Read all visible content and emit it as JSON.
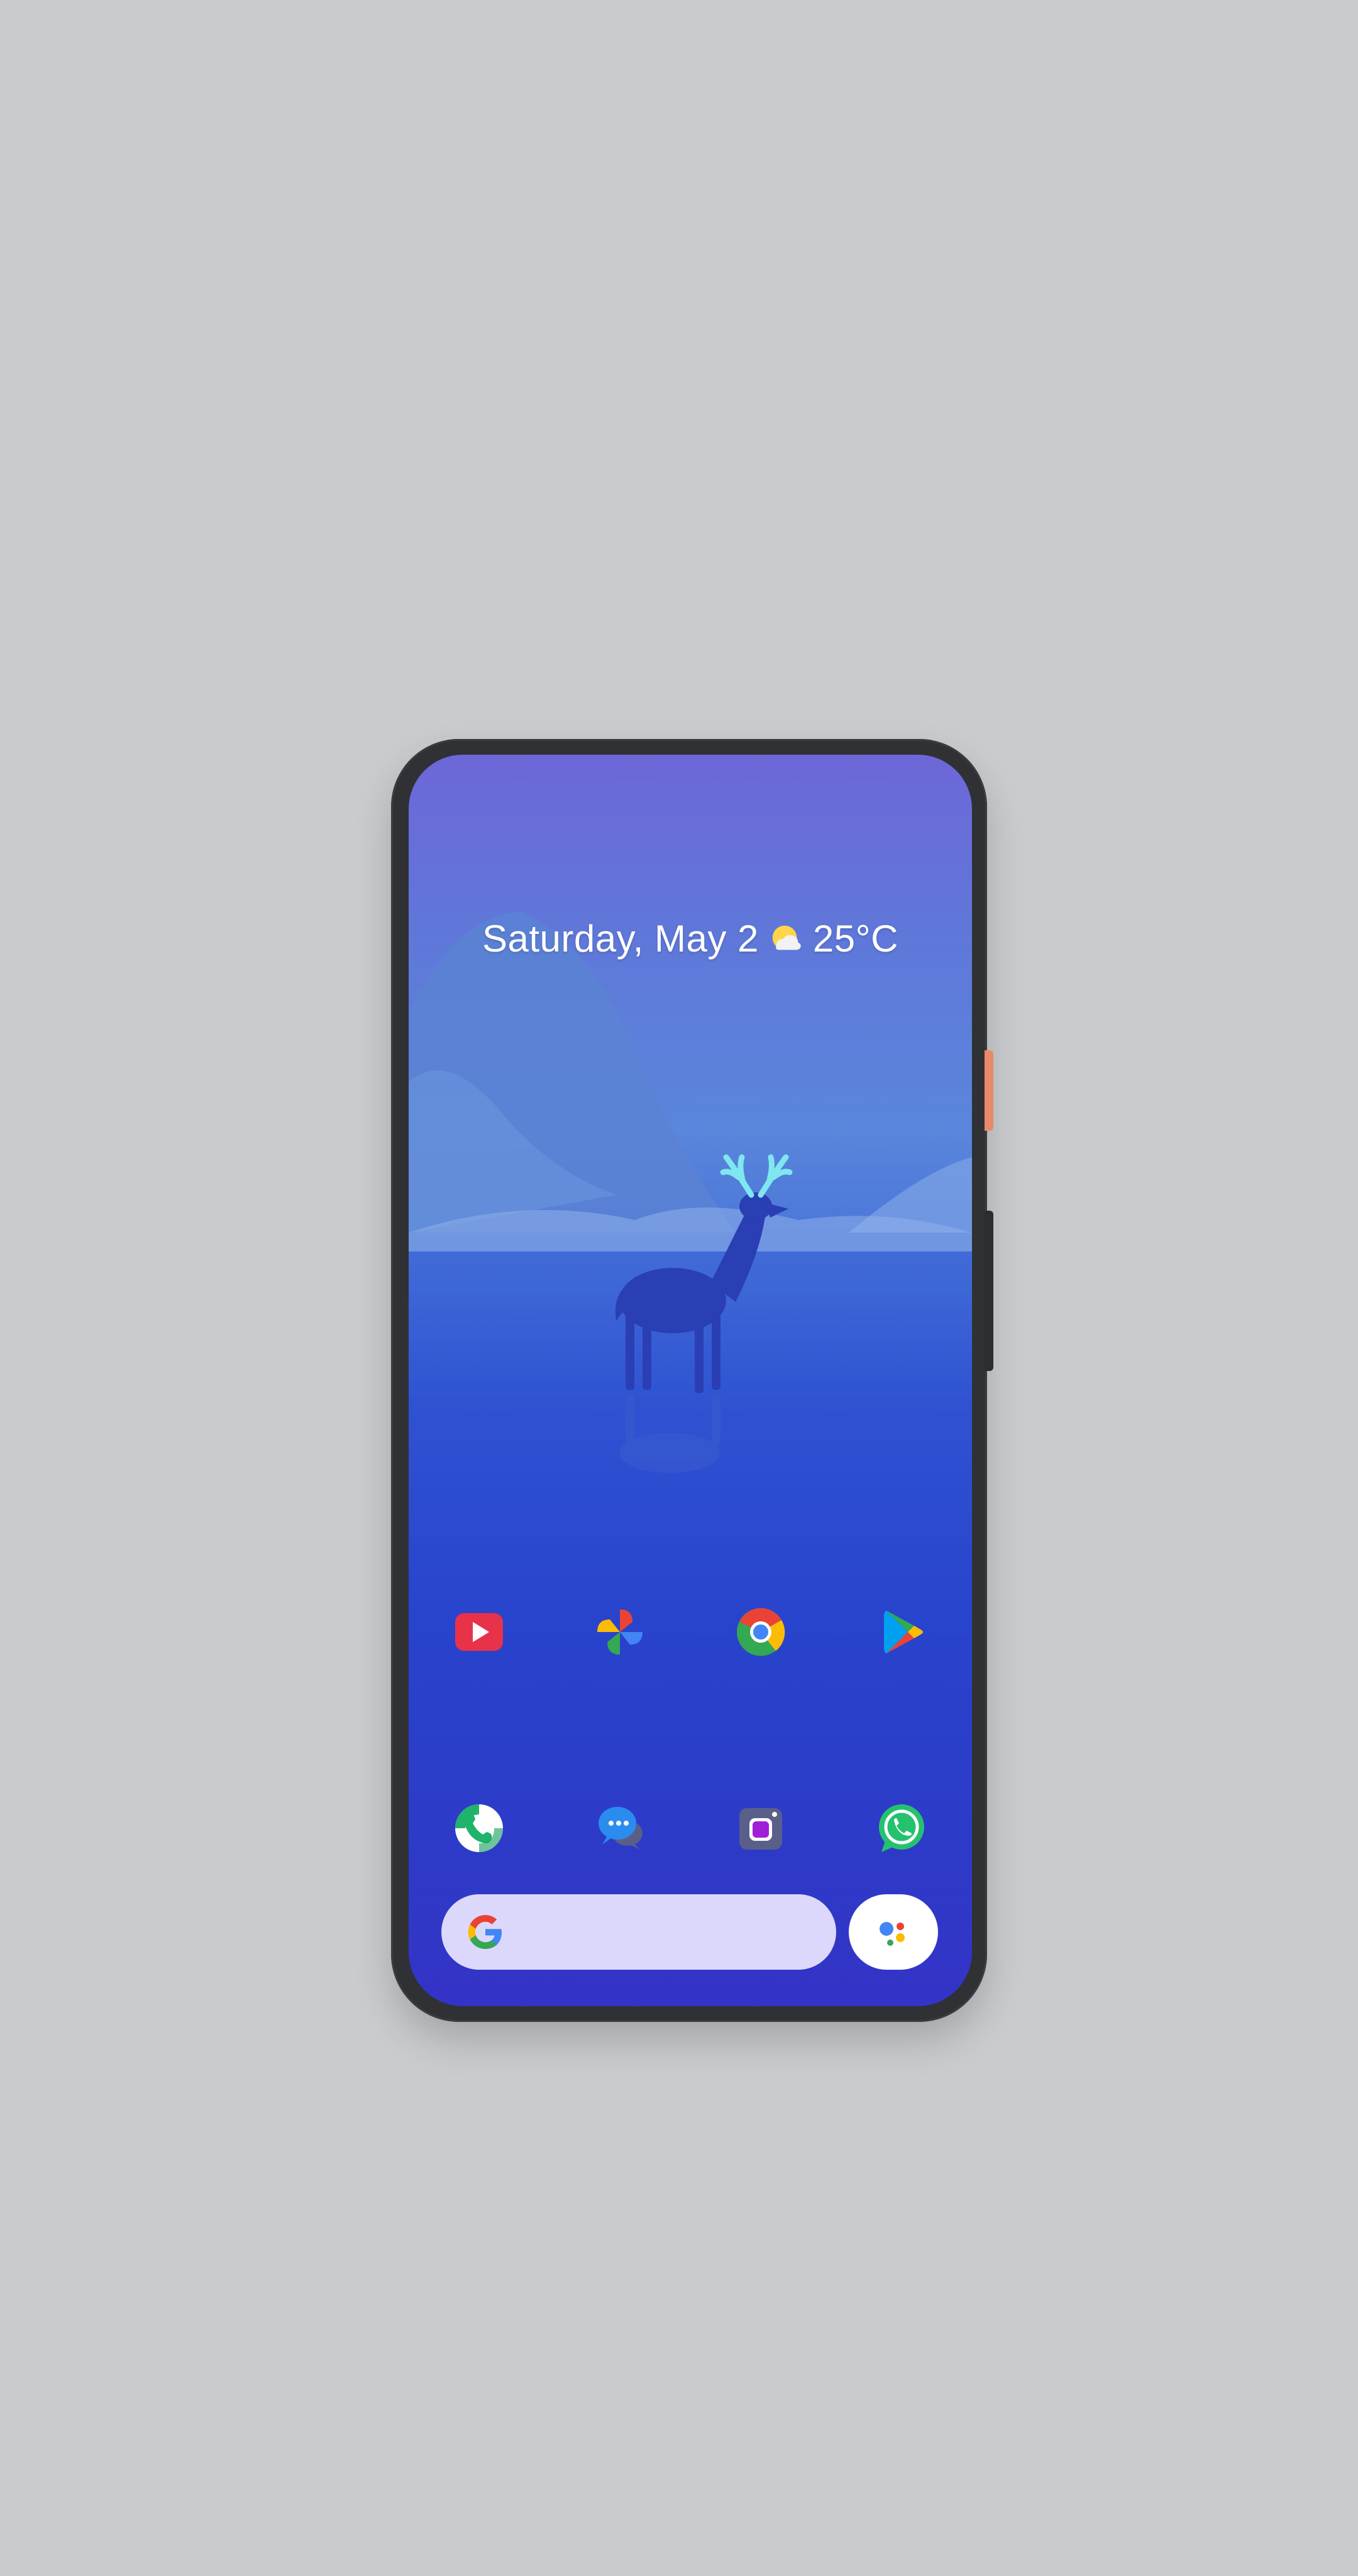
{
  "colors": {
    "background": "#c9cccf",
    "phone_frame": "#2f3134",
    "power_button": "#e88a6a",
    "search_bar": "#dcd8fb"
  },
  "at_a_glance": {
    "date": "Saturday, May 2",
    "weather_icon": "partly-sunny-icon",
    "temperature": "25°C"
  },
  "wallpaper": {
    "subject": "deer-icon"
  },
  "home_row_1": [
    {
      "app": "youtube",
      "icon": "youtube-icon"
    },
    {
      "app": "photos",
      "icon": "pinwheel-icon"
    },
    {
      "app": "chrome",
      "icon": "chrome-icon"
    },
    {
      "app": "play-store",
      "icon": "play-store-icon"
    }
  ],
  "dock": [
    {
      "app": "phone",
      "icon": "phone-icon"
    },
    {
      "app": "messages",
      "icon": "chat-bubbles-icon"
    },
    {
      "app": "camera",
      "icon": "camera-icon"
    },
    {
      "app": "whatsapp",
      "icon": "whatsapp-icon"
    }
  ],
  "search": {
    "logo": "google-g-icon",
    "assistant": "assistant-icon"
  }
}
